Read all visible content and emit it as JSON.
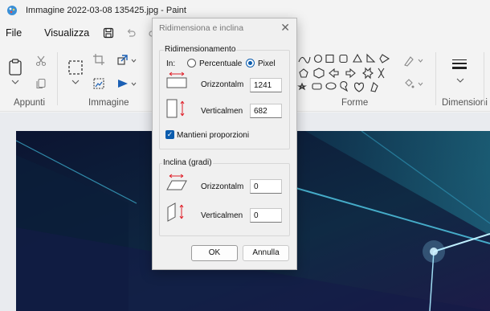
{
  "window": {
    "title": "Immagine 2022-03-08 135425.jpg - Paint"
  },
  "menu": {
    "file": "File",
    "view": "Visualizza"
  },
  "ribbon": {
    "groups": {
      "clipboard": "Appunti",
      "image": "Immagine",
      "shapes": "Forme",
      "dimensions": "Dimensioni"
    }
  },
  "dialog": {
    "title": "Ridimensiona e inclina",
    "resize": {
      "legend": "Ridimensionamento",
      "by_label": "In:",
      "option_percent": "Percentuale",
      "option_pixel": "Pixel",
      "selected": "Pixel",
      "horizontal_label": "Orizzontalm",
      "horizontal_value": "1241",
      "vertical_label": "Verticalmen",
      "vertical_value": "682",
      "keep_ratio_label": "Mantieni proporzioni",
      "keep_ratio": true
    },
    "skew": {
      "legend": "Inclina (gradi)",
      "horizontal_label": "Orizzontalm",
      "horizontal_value": "0",
      "vertical_label": "Verticalmen",
      "vertical_value": "0"
    },
    "ok_label": "OK",
    "cancel_label": "Annulla"
  },
  "colors": {
    "accent": "#0b5cad",
    "resize_arrow": "#e0202a"
  }
}
